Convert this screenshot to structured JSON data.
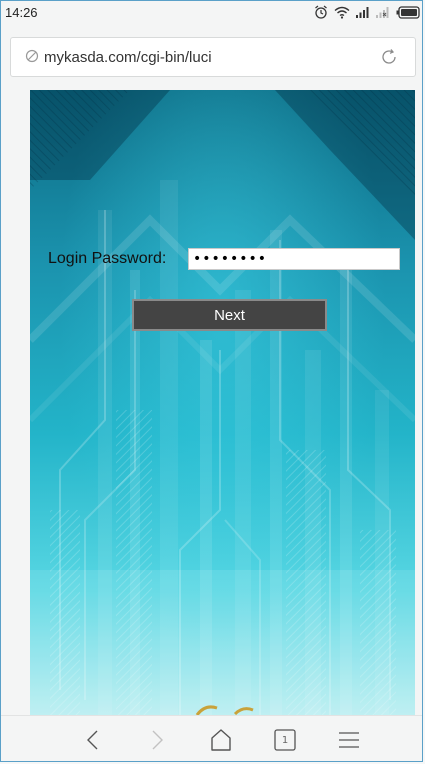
{
  "status_bar": {
    "time": "14:26",
    "icons": [
      "alarm-icon",
      "wifi-icon",
      "signal-icon",
      "signal-no-sim-icon",
      "battery-icon"
    ]
  },
  "browser": {
    "url": "mykasda.com/cgi-bin/luci",
    "tab_count": "1"
  },
  "login": {
    "label": "Login Password:",
    "password_mask": "••••••••",
    "next_label": "Next"
  },
  "colors": {
    "page_gradient_top": "#0c6a83",
    "page_gradient_bottom": "#b8eef1",
    "button_bg": "#444444",
    "frame_border": "#5aa0c8"
  }
}
